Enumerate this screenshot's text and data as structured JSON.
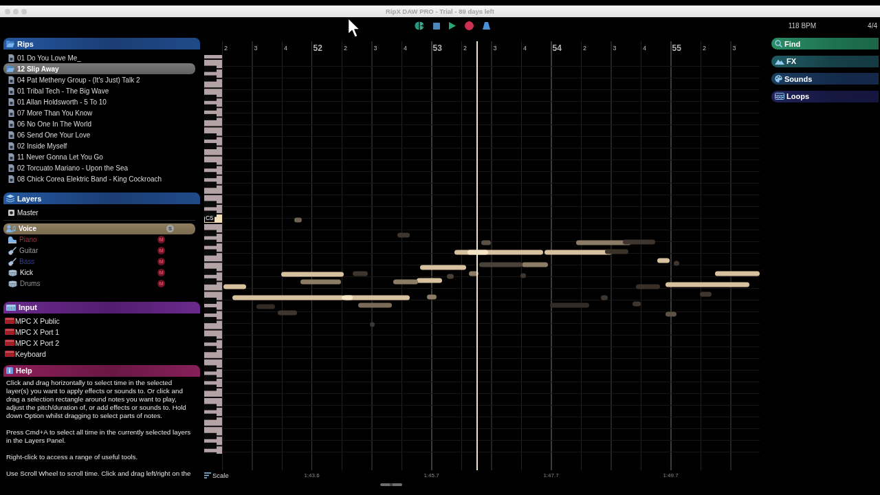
{
  "window": {
    "title": "RipX DAW PRO - Trial - 89 days left"
  },
  "transport": {
    "tempo": "118 BPM",
    "time_signature": "4/4"
  },
  "rips": {
    "title": "Rips",
    "items": [
      {
        "label": "01 Do You Love Me_",
        "kind": "file",
        "selected": false
      },
      {
        "label": "12 Slip Away",
        "kind": "folder",
        "selected": true
      },
      {
        "label": "04 Pat Metheny Group - (It's Just) Talk 2",
        "kind": "file",
        "selected": false
      },
      {
        "label": "01 Tribal Tech - The Big Wave",
        "kind": "file",
        "selected": false
      },
      {
        "label": "01 Allan Holdsworth - 5 To 10",
        "kind": "file",
        "selected": false
      },
      {
        "label": "07 More Than You Know",
        "kind": "file",
        "selected": false
      },
      {
        "label": "06 No One In The World",
        "kind": "file",
        "selected": false
      },
      {
        "label": "06 Send One Your Love",
        "kind": "file",
        "selected": false
      },
      {
        "label": "02 Inside Myself",
        "kind": "file",
        "selected": false
      },
      {
        "label": "11 Never Gonna Let You Go",
        "kind": "file",
        "selected": false
      },
      {
        "label": "02 Torcuato Mariano - Upon the Sea",
        "kind": "file",
        "selected": false
      },
      {
        "label": "08 Chick Corea Elektric Band - King Cockroach",
        "kind": "file",
        "selected": false
      }
    ]
  },
  "layers": {
    "title": "Layers",
    "master": {
      "label": "Master"
    },
    "items": [
      {
        "label": "Voice",
        "kind": "voice",
        "selected": true,
        "badge": {
          "text": "S",
          "kind": "solo"
        }
      },
      {
        "label": "Piano",
        "kind": "piano",
        "color": "#a3303d",
        "selected": false,
        "badge": {
          "text": "M",
          "kind": "mute"
        }
      },
      {
        "label": "Guitar",
        "kind": "guitar",
        "color": "#9a9a9a",
        "selected": false,
        "badge": {
          "text": "M",
          "kind": "mute"
        }
      },
      {
        "label": "Bass",
        "kind": "guitar",
        "color": "#34409a",
        "selected": false,
        "badge": {
          "text": "M",
          "kind": "mute"
        }
      },
      {
        "label": "Kick",
        "kind": "drums",
        "selected": false,
        "badge": {
          "text": "M",
          "kind": "mute"
        }
      },
      {
        "label": "Drums",
        "kind": "drums",
        "color": "#8f8f8f",
        "selected": false,
        "badge": {
          "text": "M",
          "kind": "mute"
        }
      }
    ]
  },
  "input": {
    "title": "Input",
    "items": [
      "MPC X Public",
      "MPC X Port 1",
      "MPC X Port 2",
      "Keyboard"
    ]
  },
  "help": {
    "title": "Help",
    "paragraphs": [
      "Click and drag horizontally to select time in the selected layer(s) you want to apply effects or sounds to. Or click and drag a selection rectangle around notes you want to play, adjust the pitch/duration of, or add effects or sounds to. Hold down Option whilst dragging to select parts of notes.",
      "Press Cmd+A to select all time in the currently selected layers in the Layers Panel.",
      "Right-click to access a range of useful tools.",
      "Use Scroll Wheel to scroll time. Click and drag left/right on the"
    ]
  },
  "piano_roll": {
    "ruler": [
      {
        "text": "2",
        "kind": "beat"
      },
      {
        "text": "3",
        "kind": "beat"
      },
      {
        "text": "4",
        "kind": "beat"
      },
      {
        "text": "52",
        "kind": "bar"
      },
      {
        "text": "2",
        "kind": "beat"
      },
      {
        "text": "3",
        "kind": "beat"
      },
      {
        "text": "4",
        "kind": "beat"
      },
      {
        "text": "53",
        "kind": "bar"
      },
      {
        "text": "2",
        "kind": "beat"
      },
      {
        "text": "3",
        "kind": "beat"
      },
      {
        "text": "4",
        "kind": "beat"
      },
      {
        "text": "54",
        "kind": "bar"
      },
      {
        "text": "2",
        "kind": "beat"
      },
      {
        "text": "3",
        "kind": "beat"
      },
      {
        "text": "4",
        "kind": "beat"
      },
      {
        "text": "55",
        "kind": "bar"
      },
      {
        "text": "2",
        "kind": "beat"
      },
      {
        "text": "3",
        "kind": "beat"
      }
    ],
    "key_label": "C5",
    "playhead": {
      "level": 0.474
    },
    "scale_button": "Scale",
    "time_labels": [
      "1:43.6",
      "1:45.7",
      "1:47.7",
      "1:49.7"
    ]
  },
  "browser": [
    {
      "label": "Find",
      "kind": "find"
    },
    {
      "label": "FX",
      "kind": "fx"
    },
    {
      "label": "Sounds",
      "kind": "sounds"
    },
    {
      "label": "Loops",
      "kind": "loops"
    }
  ]
}
